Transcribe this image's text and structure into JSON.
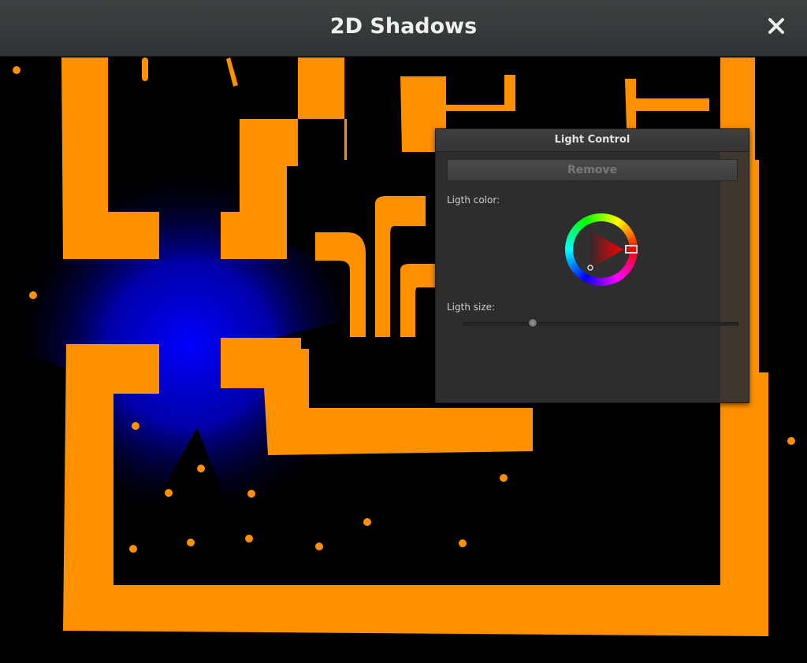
{
  "window": {
    "title": "2D Shadows",
    "close_icon": "close-icon"
  },
  "scene": {
    "light_color": "#0000ff",
    "wall_color": "#ff9000",
    "background": "#000000"
  },
  "light_control": {
    "title": "Light Control",
    "remove_label": "Remove",
    "color_label": "Ligth color:",
    "size_label": "Ligth size:",
    "selected_color": "#ff0000",
    "size_fraction": 0.25
  }
}
